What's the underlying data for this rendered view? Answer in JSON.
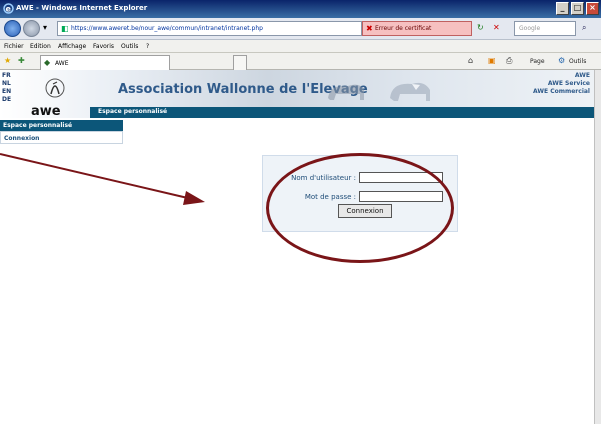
{
  "window": {
    "title": "AWE - Windows Internet Explorer",
    "buttons": [
      "_",
      "□",
      "×"
    ]
  },
  "toolbar": {
    "url": "https://www.aweret.be/nour_awe/commun/intranet/intranet.php",
    "cert_error": "Erreur de certificat",
    "search_placeholder": "Google"
  },
  "menu": [
    "Fichier",
    "Edition",
    "Affichage",
    "Favoris",
    "Outils",
    "?"
  ],
  "tab": {
    "label": "AWE"
  },
  "command_bar": {
    "page": "Page",
    "tools": "Outils"
  },
  "site": {
    "languages": [
      "FR",
      "NL",
      "EN",
      "DE"
    ],
    "logo": "awe",
    "title": "Association Wallonne de l'Elevage",
    "right_links": [
      "AWE",
      "AWE Service",
      "AWE Commercial"
    ],
    "nav_label": "Espace personnalisé"
  },
  "sidebar": {
    "header": "Espace personnalisé",
    "items": [
      {
        "label": "Connexion"
      }
    ]
  },
  "login": {
    "username_label": "Nom d'utilisateur :",
    "username_value": "",
    "password_label": "Mot de passe :",
    "password_value": "",
    "submit_label": "Connexion"
  },
  "annotation": {
    "color": "#7a1518"
  }
}
